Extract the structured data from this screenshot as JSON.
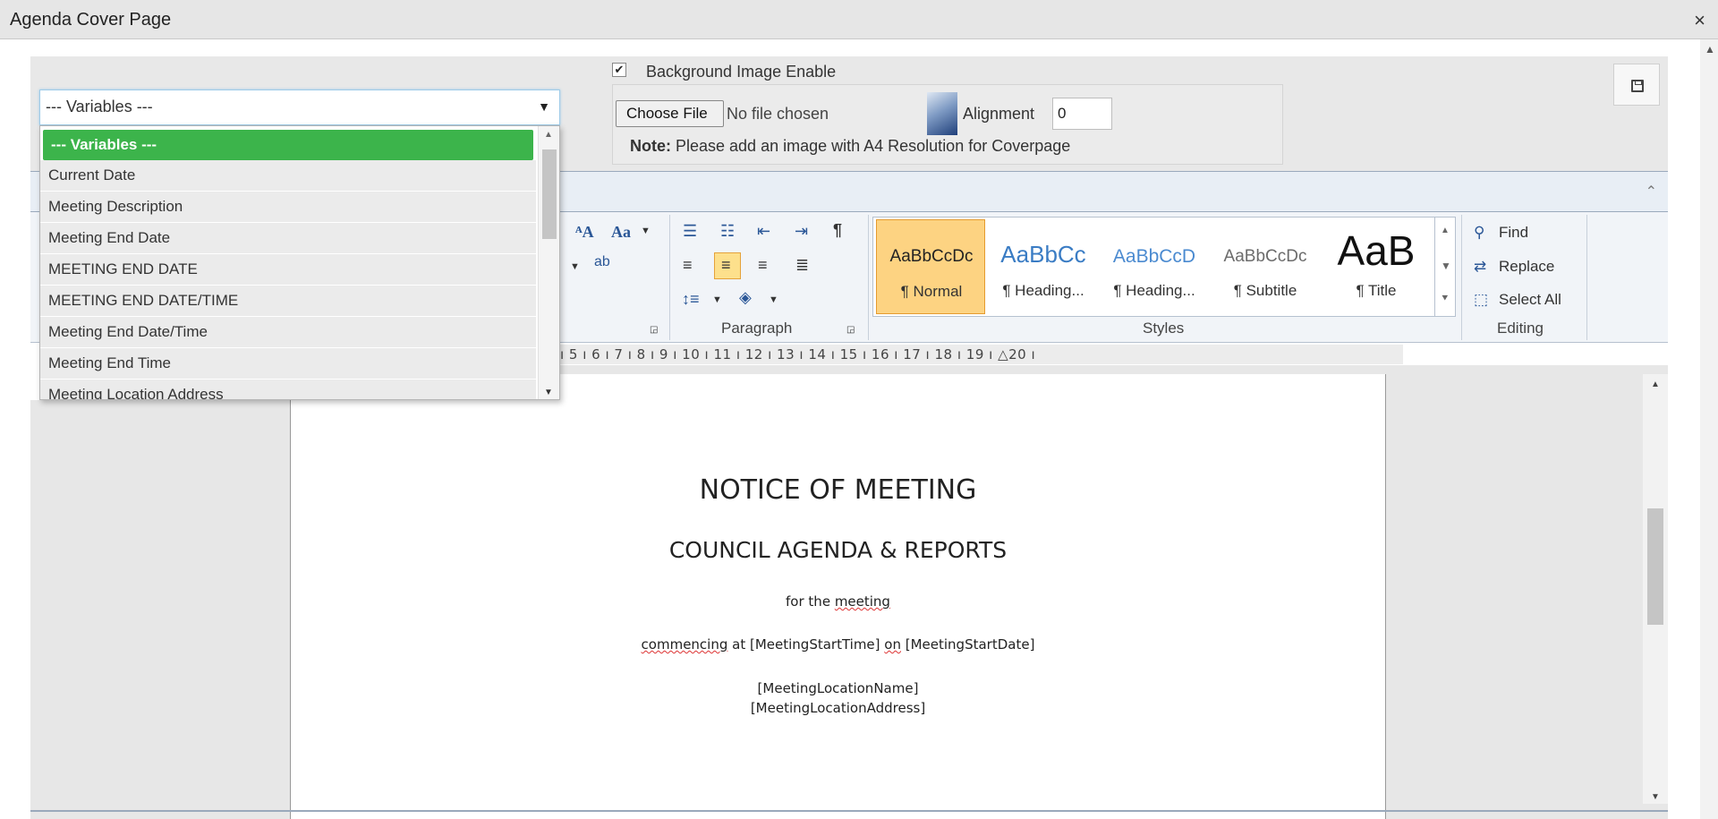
{
  "window": {
    "title": "Agenda Cover Page",
    "close_glyph": "×"
  },
  "variables_select": {
    "selected": "--- Variables ---",
    "options": [
      "--- Variables ---",
      "Current Date",
      "Meeting Description",
      "Meeting End Date",
      "MEETING END DATE",
      "MEETING END DATE/TIME",
      "Meeting End Date/Time",
      "Meeting End Time",
      "Meeting Location Address"
    ]
  },
  "background": {
    "checkbox_checked": true,
    "label": "Background Image Enable",
    "choose_file_label": "Choose File",
    "file_status": "No file chosen",
    "alignment_label": "Alignment",
    "alignment_value": "0",
    "note_bold": "Note:",
    "note_text": " Please add an image with A4 Resolution for Coverpage"
  },
  "ribbon": {
    "groups": {
      "paragraph": "Paragraph",
      "styles": "Styles",
      "editing": "Editing"
    },
    "styles": [
      {
        "sample": "AaBbCcDc",
        "label": "¶ Normal"
      },
      {
        "sample": "AaBbCc",
        "label": "¶ Heading..."
      },
      {
        "sample": "AaBbCcD",
        "label": "¶ Heading..."
      },
      {
        "sample": "AaBbCcDc",
        "label": "¶ Subtitle"
      },
      {
        "sample": "AaB",
        "label": "¶ Title"
      }
    ],
    "editing": {
      "find": "Find",
      "replace": "Replace",
      "select_all": "Select All"
    },
    "font_icons": {
      "grow": "ᴬA",
      "case": "Aa"
    }
  },
  "ruler": "ı 5 ı 6 ı 7 ı 8 ı 9 ı 10 ı 11 ı 12 ı 13 ı 14 ı 15 ı 16 ı 17 ı 18 ı 19 ı △20 ı",
  "document": {
    "heading1": "NOTICE OF MEETING",
    "heading2": "COUNCIL AGENDA & REPORTS",
    "line1_a": "for the ",
    "line1_b": "meeting",
    "line2_a": "commencing",
    "line2_b": " at [MeetingStartTime] ",
    "line2_c": "on",
    "line2_d": " [MeetingStartDate]",
    "line3": "[MeetingLocationName]",
    "line4": "[MeetingLocationAddress]"
  }
}
